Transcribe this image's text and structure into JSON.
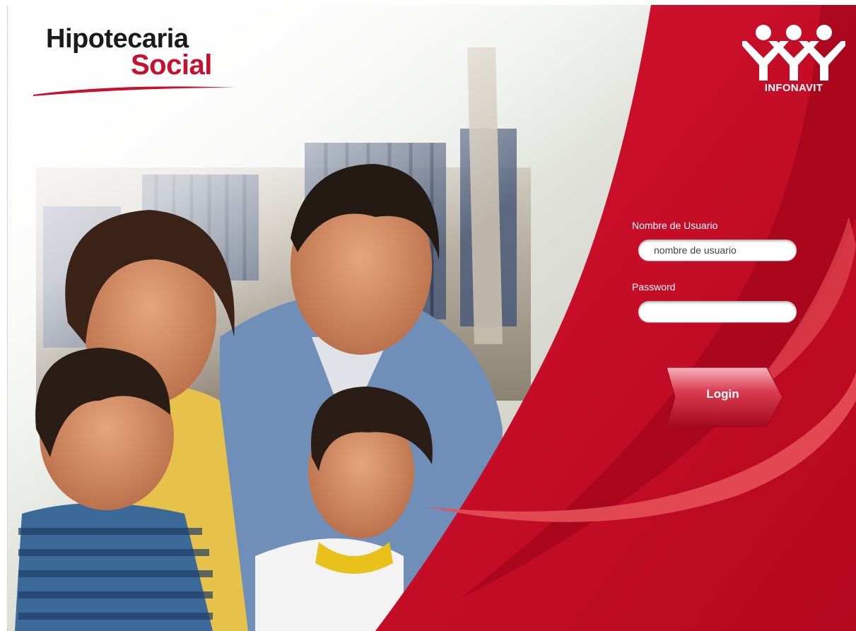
{
  "header": {
    "logo_line1": "Hipotecaria",
    "logo_line2": "Social",
    "brand_name": "INFONAVIT"
  },
  "login_form": {
    "username_label": "Nombre de Usuario",
    "username_placeholder": "nombre de usuario",
    "username_value": "",
    "password_label": "Password",
    "password_value": "",
    "login_button": "Login"
  },
  "colors": {
    "brand_red": "#c8102e",
    "panel_red": "#d0102c"
  },
  "images": {
    "hero_photo": "family-photo"
  }
}
